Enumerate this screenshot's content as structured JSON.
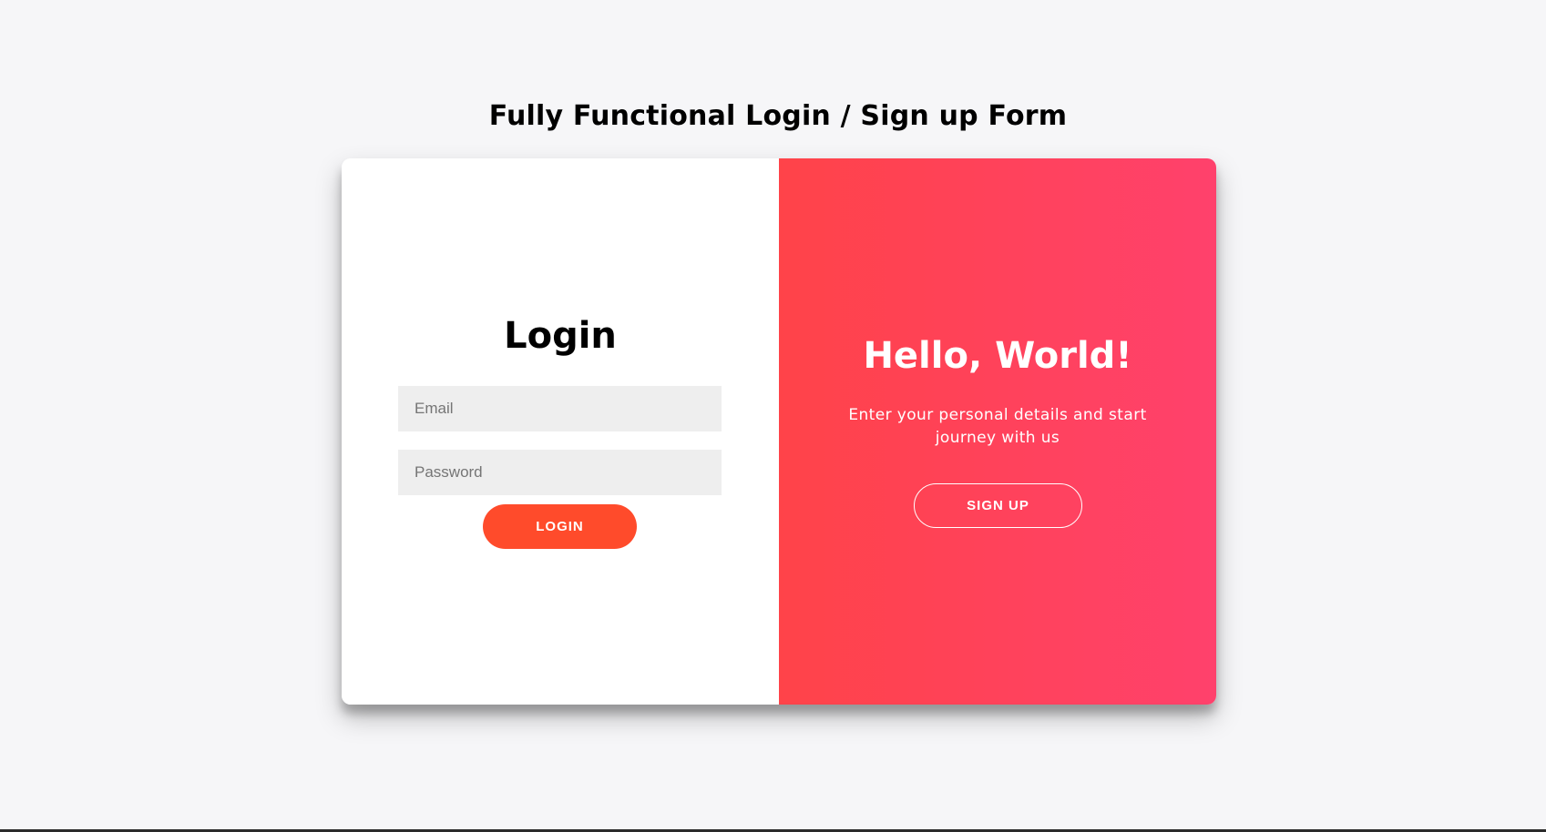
{
  "page": {
    "title": "Fully Functional Login / Sign up Form"
  },
  "login": {
    "title": "Login",
    "email_placeholder": "Email",
    "password_placeholder": "Password",
    "button_label": "LOGIN"
  },
  "signup": {
    "title": "Hello, World!",
    "text": "Enter your personal details and start journey with us",
    "button_label": "SIGN UP"
  },
  "colors": {
    "accent": "#ff4b2b",
    "gradient_start": "#ff4349",
    "gradient_end": "#ff416c",
    "page_background": "#f6f6f8",
    "input_background": "#eeeeee"
  }
}
